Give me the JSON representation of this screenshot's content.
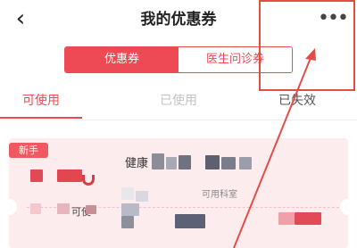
{
  "nav": {
    "back_icon": "‹",
    "title": "我的优惠券",
    "more_icon": "•••"
  },
  "segment": {
    "items": [
      {
        "label": "优惠券",
        "active": true
      },
      {
        "label": "医生问诊券",
        "active": false
      }
    ]
  },
  "tabs": [
    {
      "label": "可使用",
      "active": true
    },
    {
      "label": "已使用",
      "active": false
    },
    {
      "label": "已失效",
      "active": false
    }
  ],
  "coupon": {
    "badge": "新手",
    "name": "健康",
    "condition": "可用科室",
    "amount_label": "可使"
  },
  "colors": {
    "accent": "#ee4a55",
    "coupon_bg": "#fdeced",
    "annotation": "#e44d47"
  }
}
